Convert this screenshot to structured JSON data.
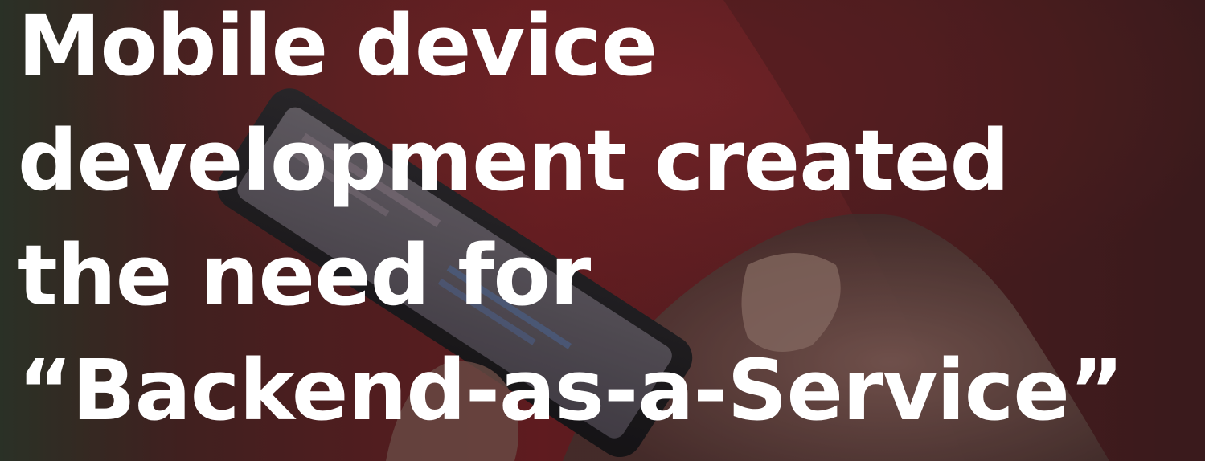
{
  "headline": {
    "line1": "Mobile device",
    "line2": "development created",
    "line3": "the need for",
    "line4": "“Backend-as-a-Service”"
  },
  "colors": {
    "text": "#ffffff",
    "background_red": "#6e1f22",
    "background_dark": "#2a1818"
  }
}
